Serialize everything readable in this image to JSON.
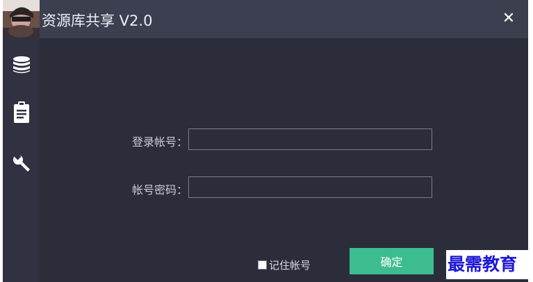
{
  "window": {
    "title": "资源库共享 V2.0",
    "close_label": "✕"
  },
  "sidebar": {
    "items": [
      {
        "icon": "database-icon"
      },
      {
        "icon": "clipboard-icon"
      },
      {
        "icon": "wrench-icon"
      }
    ]
  },
  "form": {
    "account_label": "登录帐号：",
    "account_value": "",
    "password_label": "帐号密码：",
    "password_value": "",
    "remember_label": "记住帐号",
    "remember_checked": false,
    "confirm_label": "确定"
  },
  "watermark": "最需教育",
  "colors": {
    "window_bg": "#2b2d3a",
    "titlebar_bg": "#3c3f50",
    "sidebar_bg": "#303241",
    "confirm_button": "#3dbd8f",
    "watermark_text": "#1d17d6"
  }
}
